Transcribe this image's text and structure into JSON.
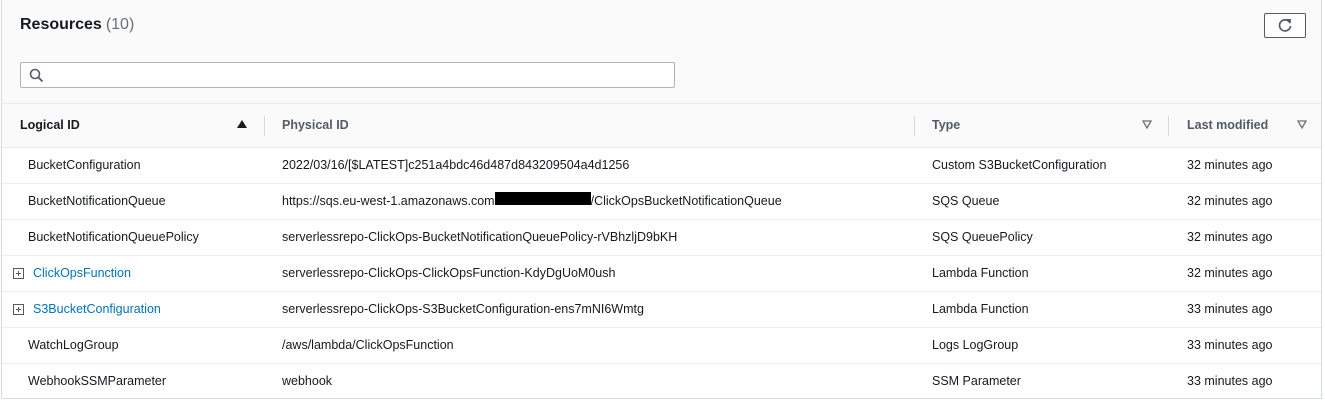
{
  "header": {
    "title": "Resources",
    "count": "(10)"
  },
  "search": {
    "placeholder": "",
    "value": ""
  },
  "icons": {
    "refresh": "refresh-icon",
    "search": "search-icon",
    "sort_asc": "sort-ascending-icon",
    "sort": "sort-icon",
    "expand": "expand-plus-icon"
  },
  "columns": {
    "logical_id": "Logical ID",
    "physical_id": "Physical ID",
    "type": "Type",
    "last_modified": "Last modified"
  },
  "rows": [
    {
      "logical_id": "BucketConfiguration",
      "physical_id": "2022/03/16/[$LATEST]c251a4bdc46d487d843209504a4d1256",
      "type": "Custom S3BucketConfiguration",
      "last_modified": "32 minutes ago"
    },
    {
      "logical_id": "BucketNotificationQueue",
      "physical_id": "https://sqs.eu-west-1.amazonaws.com/████████████/ClickOpsBucketNotificationQueue",
      "physical_id_prefix": "https://sqs.eu-west-1.amazonaws.com",
      "physical_id_suffix": "/ClickOpsBucketNotificationQueue",
      "type": "SQS Queue",
      "last_modified": "32 minutes ago"
    },
    {
      "logical_id": "BucketNotificationQueuePolicy",
      "physical_id": "serverlessrepo-ClickOps-BucketNotificationQueuePolicy-rVBhzljD9bKH",
      "type": "SQS QueuePolicy",
      "last_modified": "32 minutes ago"
    },
    {
      "logical_id": "ClickOpsFunction",
      "physical_id": "serverlessrepo-ClickOps-ClickOpsFunction-KdyDgUoM0ush",
      "type": "Lambda Function",
      "last_modified": "32 minutes ago",
      "expandable": true
    },
    {
      "logical_id": "S3BucketConfiguration",
      "physical_id": "serverlessrepo-ClickOps-S3BucketConfiguration-ens7mNI6Wmtg",
      "type": "Lambda Function",
      "last_modified": "33 minutes ago",
      "expandable": true
    },
    {
      "logical_id": "WatchLogGroup",
      "physical_id": "/aws/lambda/ClickOpsFunction",
      "type": "Logs LogGroup",
      "last_modified": "33 minutes ago"
    },
    {
      "logical_id": "WebhookSSMParameter",
      "physical_id": "webhook",
      "type": "SSM Parameter",
      "last_modified": "33 minutes ago"
    }
  ],
  "colors": {
    "link": "#0073bb",
    "border": "#eaeded",
    "header_bg": "#fafafa"
  }
}
